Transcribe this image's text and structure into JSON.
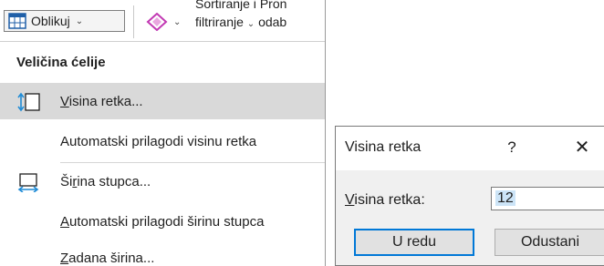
{
  "ribbon": {
    "format_label": "Oblikuj",
    "sort_filter_line1": "Sortiranje i",
    "sort_filter_line2": "filtriranje",
    "find_select_line1": "Pron",
    "find_select_line2": "odab"
  },
  "menu": {
    "section_header": "Veličina ćelije",
    "items": [
      {
        "pre": "",
        "accel": "V",
        "post": "isina retka...",
        "icon": "row-height-icon",
        "highlighted": true
      },
      {
        "pre": "Automatski prilagodi visinu retka",
        "accel": "",
        "post": "",
        "icon": null,
        "highlighted": false
      },
      {
        "pre": "Ši",
        "accel": "r",
        "post": "ina stupca...",
        "icon": "column-width-icon",
        "highlighted": false
      },
      {
        "pre": "",
        "accel": "A",
        "post": "utomatski prilagodi širinu stupca",
        "icon": null,
        "highlighted": false
      },
      {
        "pre": "",
        "accel": "Z",
        "post": "adana širina...",
        "icon": null,
        "highlighted": false
      }
    ]
  },
  "dialog": {
    "title": "Visina retka",
    "help_glyph": "?",
    "close_glyph": "✕",
    "field_label_accel": "V",
    "field_label_rest": "isina retka:",
    "field_value": "12",
    "ok_label": "U redu",
    "cancel_label": "Odustani"
  },
  "colors": {
    "highlight": "#d9d9d9",
    "accent_blue": "#0078d7",
    "eraser_pink": "#c239b3",
    "selection": "#cce4f7"
  }
}
